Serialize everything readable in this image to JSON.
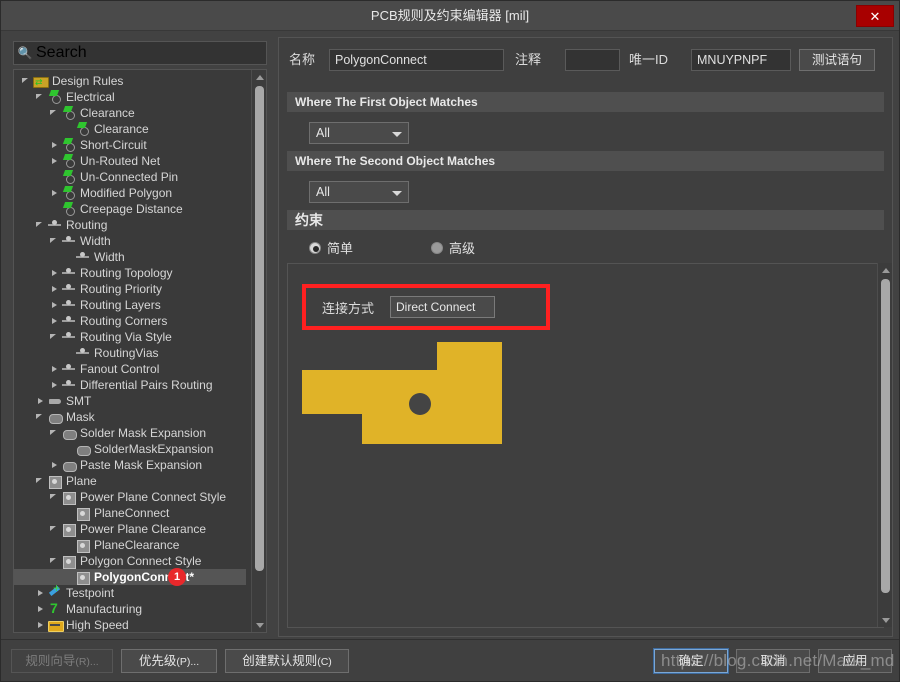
{
  "window": {
    "title": "PCB规则及约束编辑器 [mil]",
    "close_label": "✕"
  },
  "search": {
    "placeholder": "Search",
    "value": "Search",
    "icon": "search-icon"
  },
  "tree": {
    "items": [
      {
        "label": "Design Rules",
        "depth": 0,
        "twisty": "expanded",
        "icon": "folder-icon",
        "selected": false
      },
      {
        "label": "Electrical",
        "depth": 1,
        "twisty": "expanded",
        "icon": "electrical-icon",
        "selected": false
      },
      {
        "label": "Clearance",
        "depth": 2,
        "twisty": "expanded",
        "icon": "electrical-icon",
        "selected": false
      },
      {
        "label": "Clearance",
        "depth": 3,
        "twisty": "none",
        "icon": "electrical-icon",
        "selected": false
      },
      {
        "label": "Short-Circuit",
        "depth": 2,
        "twisty": "collapsed",
        "icon": "electrical-icon",
        "selected": false
      },
      {
        "label": "Un-Routed Net",
        "depth": 2,
        "twisty": "collapsed",
        "icon": "electrical-icon",
        "selected": false
      },
      {
        "label": "Un-Connected Pin",
        "depth": 2,
        "twisty": "none",
        "icon": "electrical-icon",
        "selected": false
      },
      {
        "label": "Modified Polygon",
        "depth": 2,
        "twisty": "collapsed",
        "icon": "electrical-icon",
        "selected": false
      },
      {
        "label": "Creepage Distance",
        "depth": 2,
        "twisty": "none",
        "icon": "electrical-icon",
        "selected": false
      },
      {
        "label": "Routing",
        "depth": 1,
        "twisty": "expanded",
        "icon": "routing-icon",
        "selected": false
      },
      {
        "label": "Width",
        "depth": 2,
        "twisty": "expanded",
        "icon": "routing-icon",
        "selected": false
      },
      {
        "label": "Width",
        "depth": 3,
        "twisty": "none",
        "icon": "routing-icon",
        "selected": false
      },
      {
        "label": "Routing Topology",
        "depth": 2,
        "twisty": "collapsed",
        "icon": "routing-icon",
        "selected": false
      },
      {
        "label": "Routing Priority",
        "depth": 2,
        "twisty": "collapsed",
        "icon": "routing-icon",
        "selected": false
      },
      {
        "label": "Routing Layers",
        "depth": 2,
        "twisty": "collapsed",
        "icon": "routing-icon",
        "selected": false
      },
      {
        "label": "Routing Corners",
        "depth": 2,
        "twisty": "collapsed",
        "icon": "routing-icon",
        "selected": false
      },
      {
        "label": "Routing Via Style",
        "depth": 2,
        "twisty": "expanded",
        "icon": "routing-icon",
        "selected": false
      },
      {
        "label": "RoutingVias",
        "depth": 3,
        "twisty": "none",
        "icon": "routing-icon",
        "selected": false
      },
      {
        "label": "Fanout Control",
        "depth": 2,
        "twisty": "collapsed",
        "icon": "routing-icon",
        "selected": false
      },
      {
        "label": "Differential Pairs Routing",
        "depth": 2,
        "twisty": "collapsed",
        "icon": "routing-icon",
        "selected": false
      },
      {
        "label": "SMT",
        "depth": 1,
        "twisty": "collapsed",
        "icon": "smt-icon",
        "selected": false
      },
      {
        "label": "Mask",
        "depth": 1,
        "twisty": "expanded",
        "icon": "mask-icon",
        "selected": false
      },
      {
        "label": "Solder Mask Expansion",
        "depth": 2,
        "twisty": "expanded",
        "icon": "mask-icon",
        "selected": false
      },
      {
        "label": "SolderMaskExpansion",
        "depth": 3,
        "twisty": "none",
        "icon": "mask-icon",
        "selected": false
      },
      {
        "label": "Paste Mask Expansion",
        "depth": 2,
        "twisty": "collapsed",
        "icon": "mask-icon",
        "selected": false
      },
      {
        "label": "Plane",
        "depth": 1,
        "twisty": "expanded",
        "icon": "plane-icon",
        "selected": false
      },
      {
        "label": "Power Plane Connect Style",
        "depth": 2,
        "twisty": "expanded",
        "icon": "plane-icon",
        "selected": false
      },
      {
        "label": "PlaneConnect",
        "depth": 3,
        "twisty": "none",
        "icon": "plane-icon",
        "selected": false
      },
      {
        "label": "Power Plane Clearance",
        "depth": 2,
        "twisty": "expanded",
        "icon": "plane-icon",
        "selected": false
      },
      {
        "label": "PlaneClearance",
        "depth": 3,
        "twisty": "none",
        "icon": "plane-icon",
        "selected": false
      },
      {
        "label": "Polygon Connect Style",
        "depth": 2,
        "twisty": "expanded",
        "icon": "plane-icon",
        "selected": false
      },
      {
        "label": "PolygonConnect*",
        "depth": 3,
        "twisty": "none",
        "icon": "plane-icon",
        "selected": true,
        "badge": "1"
      },
      {
        "label": "Testpoint",
        "depth": 1,
        "twisty": "collapsed",
        "icon": "testpoint-icon",
        "selected": false
      },
      {
        "label": "Manufacturing",
        "depth": 1,
        "twisty": "collapsed",
        "icon": "manufacturing-icon",
        "selected": false
      },
      {
        "label": "High Speed",
        "depth": 1,
        "twisty": "collapsed",
        "icon": "high-speed-icon",
        "selected": false
      }
    ]
  },
  "form": {
    "name_label": "名称",
    "name_value": "PolygonConnect",
    "comment_label": "注释",
    "comment_value": "",
    "uid_label": "唯一ID",
    "uid_value": "MNUYPNPF",
    "test_query_button": "测试语句"
  },
  "first_object": {
    "header": "Where The First Object Matches",
    "scope_value": "All"
  },
  "second_object": {
    "header": "Where The Second Object Matches",
    "scope_value": "All"
  },
  "constraints": {
    "header": "约束",
    "mode_simple": "简单",
    "mode_advanced": "高级",
    "selected_mode": "简单",
    "connect_style_label": "连接方式",
    "connect_style_value": "Direct Connect",
    "highlight_color": "#ff2020",
    "polygon_fill": "#e0b328",
    "hole_color": "#444444"
  },
  "footer": {
    "rule_wizard": "规则向导",
    "rule_wizard_hint": "(R)...",
    "priority": "优先级",
    "priority_hint": "(P)...",
    "create_default": "创建默认规则",
    "create_default_hint": "(C)",
    "ok": "确定",
    "cancel": "取消",
    "apply": "应用"
  },
  "watermark": {
    "text": "https://blog.csdn.net/Mark_md"
  }
}
